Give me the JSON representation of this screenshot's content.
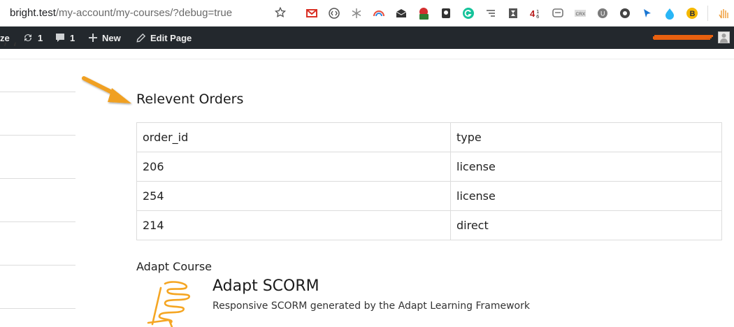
{
  "browser": {
    "url_host": "bright.test",
    "url_path": "/my-account/my-courses/?debug=true",
    "extensions": [
      {
        "name": "gmail-icon",
        "color": "#d93025"
      },
      {
        "name": "code-bracket-icon",
        "color": "#555555"
      },
      {
        "name": "snowflake-icon",
        "color": "#8a8a8a"
      },
      {
        "name": "rainbow-arc-icon",
        "color": "#e74c3c"
      },
      {
        "name": "mail-envelope-icon",
        "color": "#333333"
      },
      {
        "name": "timer-badge-icon",
        "color": "#2e7d32",
        "badge": "1m"
      },
      {
        "name": "lightbulb-icon",
        "color": "#333333"
      },
      {
        "name": "grammarly-icon",
        "color": "#15c39a"
      },
      {
        "name": "list-indent-icon",
        "color": "#555555"
      },
      {
        "name": "hourglass-icon",
        "color": "#555555"
      },
      {
        "name": "counter-icon",
        "color": "#b71c1c",
        "badge": "4"
      },
      {
        "name": "chat-bubble-icon",
        "color": "#777777"
      },
      {
        "name": "crx-icon",
        "color": "#555555",
        "badge": "CRX"
      },
      {
        "name": "u-circle-icon",
        "color": "#7a7a7a"
      },
      {
        "name": "record-circle-icon",
        "color": "#444444"
      },
      {
        "name": "cursor-arrow-icon",
        "color": "#1976d2"
      },
      {
        "name": "droplet-icon",
        "color": "#29b6f6"
      },
      {
        "name": "b-circle-icon",
        "color": "#f5b800",
        "badge": "B"
      },
      {
        "name": "hand-icon",
        "color": "#f0a040"
      }
    ]
  },
  "admin_bar": {
    "customize_partial": "ze",
    "updates_count": "1",
    "comments_count": "1",
    "new_label": "New",
    "edit_page_label": "Edit Page"
  },
  "orders": {
    "heading": "Relevent Orders",
    "columns": [
      "order_id",
      "type"
    ],
    "rows": [
      {
        "order_id": "206",
        "type": "license"
      },
      {
        "order_id": "254",
        "type": "license"
      },
      {
        "order_id": "214",
        "type": "direct"
      }
    ]
  },
  "course": {
    "section_label": "Adapt Course",
    "title": "Adapt SCORM",
    "description": "Responsive SCORM generated by the Adapt Learning Framework"
  },
  "colors": {
    "admin_bar_bg": "#23282d",
    "annotation_arrow": "#f0a020",
    "adapt_logo": "#f5a623"
  }
}
